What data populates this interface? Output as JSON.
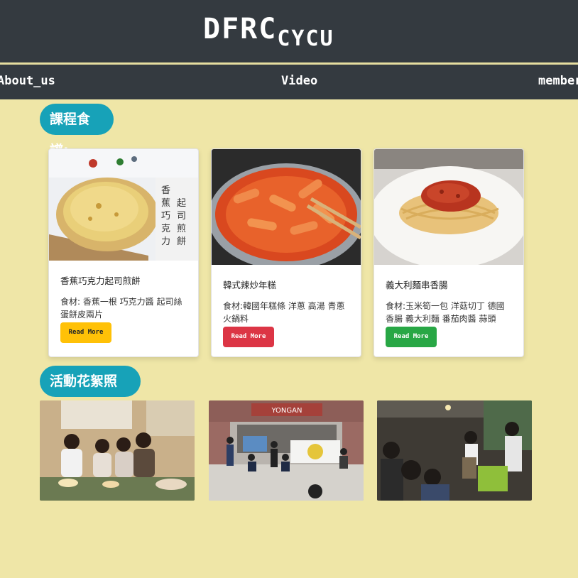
{
  "header": {
    "logo_main": "DFRC",
    "logo_sub": "CYCU"
  },
  "nav": {
    "items": [
      "About_us",
      "Video",
      "member"
    ]
  },
  "recipes_heading": "課程食譜:",
  "recipes": [
    {
      "title": "香蕉巧克力起司煎餅",
      "text": "食材: 香蕉一根 巧克力醬 起司絲 蛋餅皮兩片",
      "button": "Read More",
      "button_color": "#ffc107",
      "image": "cheese-pancake-photo"
    },
    {
      "title": "韓式辣炒年糕",
      "text": "食材:韓國年糕條 洋蔥 高湯 青蔥 火鍋料",
      "button": "Read More",
      "button_color": "#dc3545",
      "image": "tteokbokki-photo"
    },
    {
      "title": "義大利麵串香腸",
      "text": "食材:玉米筍一包 洋菇切丁 德國香腸 義大利麵 番茄肉醬 蒜頭",
      "button": "Read More",
      "button_color": "#28a745",
      "image": "spaghetti-photo"
    }
  ],
  "photos_heading": "活動花絮照片:",
  "photos": [
    {
      "image": "group-dinner-photo"
    },
    {
      "image": "outdoor-group-photo",
      "sign": "YONGAN"
    },
    {
      "image": "cooking-class-photo"
    }
  ],
  "colors": {
    "header_bg": "#343a40",
    "page_bg": "#efe6a7",
    "pill_bg": "#17a2b8"
  }
}
